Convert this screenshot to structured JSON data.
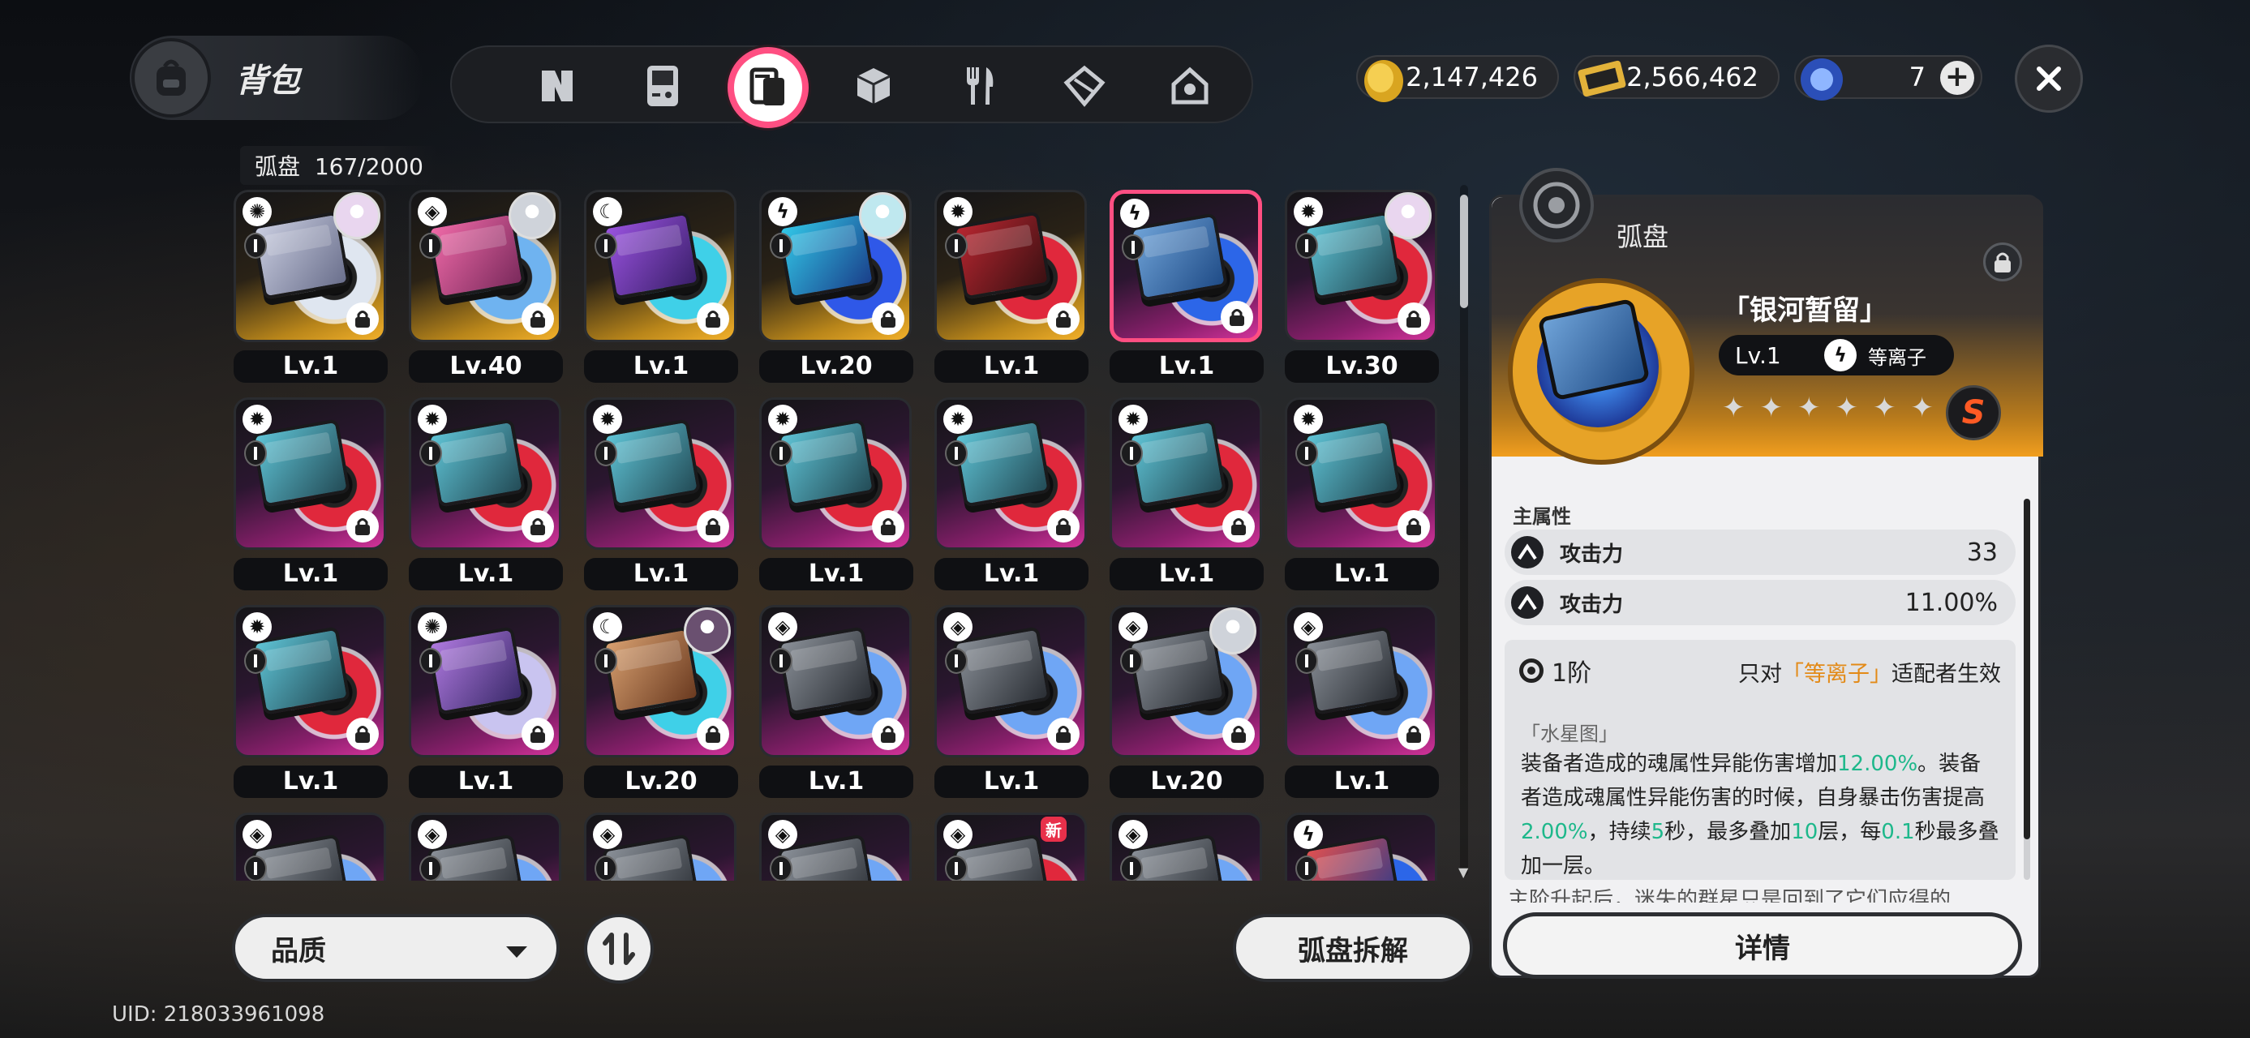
{
  "header": {
    "title": "背包",
    "tabs": [
      {
        "name": "tab-n-items",
        "icon": "n-logo-icon",
        "active": false
      },
      {
        "name": "tab-devices",
        "icon": "gameboy-icon",
        "active": false
      },
      {
        "name": "tab-arc-discs",
        "icon": "disc-card-icon",
        "active": true
      },
      {
        "name": "tab-materials",
        "icon": "cube-icon",
        "active": false
      },
      {
        "name": "tab-food",
        "icon": "fork-knife-icon",
        "active": false
      },
      {
        "name": "tab-modules",
        "icon": "crystal-icon",
        "active": false
      },
      {
        "name": "tab-home",
        "icon": "home-icon",
        "active": false
      }
    ]
  },
  "currencies": [
    {
      "name": "gold-coin",
      "value": "2,147,426",
      "icon": "gold-coin-icon"
    },
    {
      "name": "ticket",
      "value": "2,566,462",
      "icon": "ticket-icon"
    },
    {
      "name": "blue-crystal",
      "value": "7",
      "icon": "blue-crystal-icon",
      "has_plus": true
    }
  ],
  "inventory": {
    "label": "弧盘",
    "count": "167/2000",
    "items": [
      {
        "level": "Lv.1",
        "bg": "gold",
        "attr": "swirl",
        "avatar": true,
        "ring": "#dfe6f0",
        "b1": "#c9cde0",
        "b2": "#6a6f8c"
      },
      {
        "level": "Lv.40",
        "bg": "gold",
        "attr": "cube",
        "avatar": true,
        "ring": "#6fb3f0",
        "b1": "#f06aa8",
        "b2": "#7a2a5c"
      },
      {
        "level": "Lv.1",
        "bg": "gold",
        "attr": "moon",
        "avatar": false,
        "ring": "#3fd0e8",
        "b1": "#9a53e0",
        "b2": "#3a1f6a"
      },
      {
        "level": "Lv.20",
        "bg": "gold",
        "attr": "bolt",
        "avatar": true,
        "ring": "#2f58e8",
        "b1": "#32c8e8",
        "b2": "#1a3f8a"
      },
      {
        "level": "Lv.1",
        "bg": "gold",
        "attr": "gear",
        "avatar": false,
        "ring": "#e0283c",
        "b1": "#b82630",
        "b2": "#3a1012"
      },
      {
        "level": "Lv.1",
        "bg": "purple",
        "attr": "bolt",
        "avatar": false,
        "ring": "#2c66e8",
        "b1": "#6fa3d8",
        "b2": "#1f4b86",
        "selected": true
      },
      {
        "level": "Lv.30",
        "bg": "purple",
        "attr": "gear",
        "avatar": true,
        "ring": "#e0283c",
        "b1": "#5fc4d6",
        "b2": "#234b56"
      },
      {
        "level": "Lv.1",
        "bg": "purple",
        "attr": "gear",
        "avatar": false,
        "ring": "#e0283c",
        "b1": "#5fc4d6",
        "b2": "#234b56"
      },
      {
        "level": "Lv.1",
        "bg": "purple",
        "attr": "gear",
        "avatar": false,
        "ring": "#e0283c",
        "b1": "#5fc4d6",
        "b2": "#234b56"
      },
      {
        "level": "Lv.1",
        "bg": "purple",
        "attr": "gear",
        "avatar": false,
        "ring": "#e0283c",
        "b1": "#5fc4d6",
        "b2": "#234b56"
      },
      {
        "level": "Lv.1",
        "bg": "purple",
        "attr": "gear",
        "avatar": false,
        "ring": "#e0283c",
        "b1": "#5fc4d6",
        "b2": "#234b56"
      },
      {
        "level": "Lv.1",
        "bg": "purple",
        "attr": "gear",
        "avatar": false,
        "ring": "#e0283c",
        "b1": "#5fc4d6",
        "b2": "#234b56"
      },
      {
        "level": "Lv.1",
        "bg": "purple",
        "attr": "gear",
        "avatar": false,
        "ring": "#e0283c",
        "b1": "#5fc4d6",
        "b2": "#234b56"
      },
      {
        "level": "Lv.1",
        "bg": "purple",
        "attr": "gear",
        "avatar": false,
        "ring": "#e0283c",
        "b1": "#5fc4d6",
        "b2": "#234b56"
      },
      {
        "level": "Lv.1",
        "bg": "purple",
        "attr": "gear",
        "avatar": false,
        "ring": "#e0283c",
        "b1": "#5fc4d6",
        "b2": "#234b56"
      },
      {
        "level": "Lv.1",
        "bg": "purple",
        "attr": "swirl",
        "avatar": false,
        "ring": "#c9c4f0",
        "b1": "#b07ae0",
        "b2": "#3a2a6a"
      },
      {
        "level": "Lv.20",
        "bg": "purple",
        "attr": "moon",
        "avatar": true,
        "ring": "#3fd0e8",
        "b1": "#d8a070",
        "b2": "#6a3a20"
      },
      {
        "level": "Lv.1",
        "bg": "purple",
        "attr": "cube",
        "avatar": false,
        "ring": "#6fa6f5",
        "b1": "#8a9098",
        "b2": "#2a2e34"
      },
      {
        "level": "Lv.1",
        "bg": "purple",
        "attr": "cube",
        "avatar": false,
        "ring": "#6fa6f5",
        "b1": "#8a9098",
        "b2": "#2a2e34"
      },
      {
        "level": "Lv.20",
        "bg": "purple",
        "attr": "cube",
        "avatar": true,
        "ring": "#6fa6f5",
        "b1": "#8a9098",
        "b2": "#2a2e34"
      },
      {
        "level": "Lv.1",
        "bg": "purple",
        "attr": "cube",
        "avatar": false,
        "ring": "#6fa6f5",
        "b1": "#8a9098",
        "b2": "#2a2e34"
      },
      {
        "level": "",
        "bg": "purple",
        "attr": "cube",
        "avatar": false,
        "ring": "#6fa6f5",
        "b1": "#8a9098",
        "b2": "#2a2e34"
      },
      {
        "level": "",
        "bg": "purple",
        "attr": "cube",
        "avatar": false,
        "ring": "#6fa6f5",
        "b1": "#8a9098",
        "b2": "#2a2e34"
      },
      {
        "level": "",
        "bg": "purple",
        "attr": "cube",
        "avatar": false,
        "ring": "#6fa6f5",
        "b1": "#8a9098",
        "b2": "#2a2e34"
      },
      {
        "level": "",
        "bg": "purple",
        "attr": "cube",
        "avatar": false,
        "ring": "#6fa6f5",
        "b1": "#8a9098",
        "b2": "#2a2e34"
      },
      {
        "level": "",
        "bg": "purple",
        "attr": "cube",
        "avatar": false,
        "ring": "#e0283c",
        "b1": "#8a9098",
        "b2": "#2a2e34",
        "new": "新"
      },
      {
        "level": "",
        "bg": "purple",
        "attr": "cube",
        "avatar": false,
        "ring": "#6fa6f5",
        "b1": "#8a9098",
        "b2": "#2a2e34"
      },
      {
        "level": "",
        "bg": "purple",
        "attr": "bolt",
        "avatar": false,
        "ring": "#2c66e8",
        "b1": "#e05050",
        "b2": "#2a3a8a"
      }
    ]
  },
  "controls": {
    "quality_label": "品质",
    "dismantle_label": "弧盘拆解",
    "uid": "UID: 218033961098"
  },
  "detail": {
    "kind": "弧盘",
    "name": "「银河暂留」",
    "level": "Lv.1",
    "attribute": "等离子",
    "attribute_icon": "bolt-icon",
    "rarity": "S",
    "main_attr_label": "主属性",
    "stats": [
      {
        "name": "攻击力",
        "value": "33"
      },
      {
        "name": "攻击力",
        "value": "11.00%"
      }
    ],
    "tier": "1阶",
    "only_prefix": "只对",
    "only_highlight": "「等离子」",
    "only_suffix": "适配者生效",
    "set_name": "「水星图」",
    "effect": [
      {
        "t": "装备者造成的魂属性异能伤害增加",
        "g": false
      },
      {
        "t": "12.00%",
        "g": true
      },
      {
        "t": "。装备者造成魂属性异能伤害的时候，自身暴击伤害提高",
        "g": false
      },
      {
        "t": "2.00%",
        "g": true
      },
      {
        "t": "，持续",
        "g": false
      },
      {
        "t": "5",
        "g": true
      },
      {
        "t": "秒，最多叠加",
        "g": false
      },
      {
        "t": "10",
        "g": true
      },
      {
        "t": "层，每",
        "g": false
      },
      {
        "t": "0.1",
        "g": true
      },
      {
        "t": "秒最多叠加一层。",
        "g": false
      }
    ],
    "more_text": "主阶升起后，迷失的群星只是回到了它们应得的",
    "details_button": "详情"
  }
}
